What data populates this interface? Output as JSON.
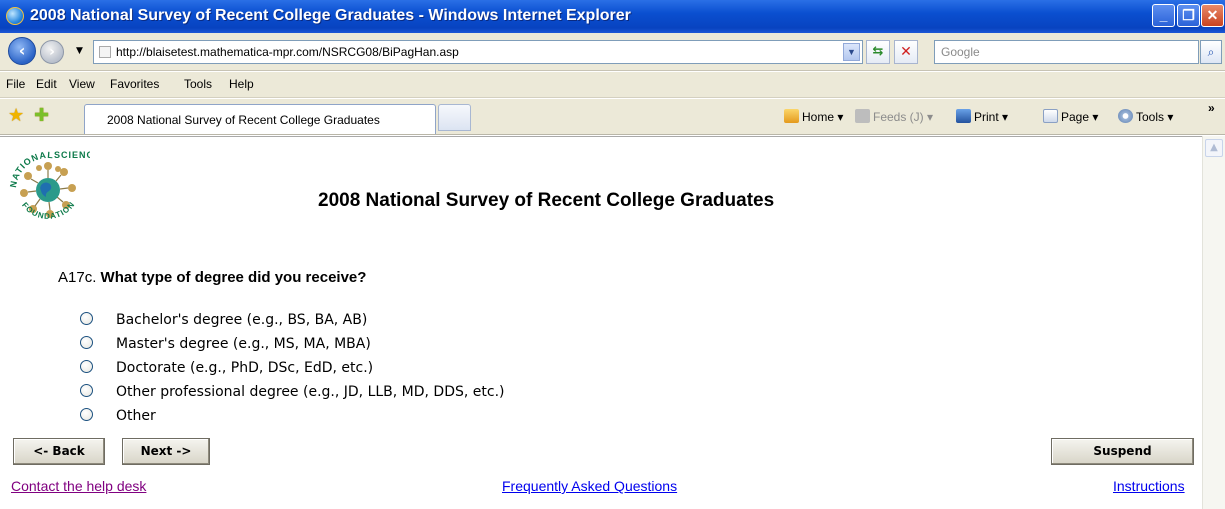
{
  "window": {
    "title": "2008 National Survey of Recent College Graduates - Windows Internet Explorer",
    "minimize": "_",
    "restore": "❐",
    "close": "✕"
  },
  "address_bar": {
    "url": "http://blaisetest.mathematica-mpr.com/NSRCG08/BiPagHan.asp",
    "search_placeholder": "Google"
  },
  "menu": [
    "File",
    "Edit",
    "View",
    "Favorites",
    "Tools",
    "Help"
  ],
  "tabs": {
    "active_tab_label": "2008 National Survey of Recent College Graduates"
  },
  "command_bar": {
    "home": "Home",
    "feeds": "Feeds (J)",
    "print": "Print",
    "page": "Page",
    "tools": "Tools",
    "overflow": "»"
  },
  "page": {
    "title": "2008 National Survey of Recent College Graduates",
    "seal_text": [
      "NATIONAL",
      "SCIENCE",
      "FOUNDATION"
    ],
    "question_id": "A17c.",
    "question_text": "What type of degree did you receive?",
    "options": [
      "Bachelor's degree (e.g., BS, BA, AB)",
      "Master's degree (e.g., MS, MA, MBA)",
      "Doctorate (e.g., PhD, DSc, EdD, etc.)",
      "Other professional degree (e.g., JD, LLB, MD, DDS, etc.)",
      "Other"
    ],
    "selected_option": null,
    "buttons": {
      "back": "<- Back",
      "next": "Next ->",
      "suspend": "Suspend"
    },
    "links": {
      "help_desk": "Contact the help desk",
      "faq": "Frequently Asked Questions",
      "instructions": "Instructions"
    }
  },
  "colors": {
    "titlebar": "#0a4fd0",
    "chrome": "#ece9d8",
    "visited_link": "#800080",
    "link": "#0000ee"
  }
}
